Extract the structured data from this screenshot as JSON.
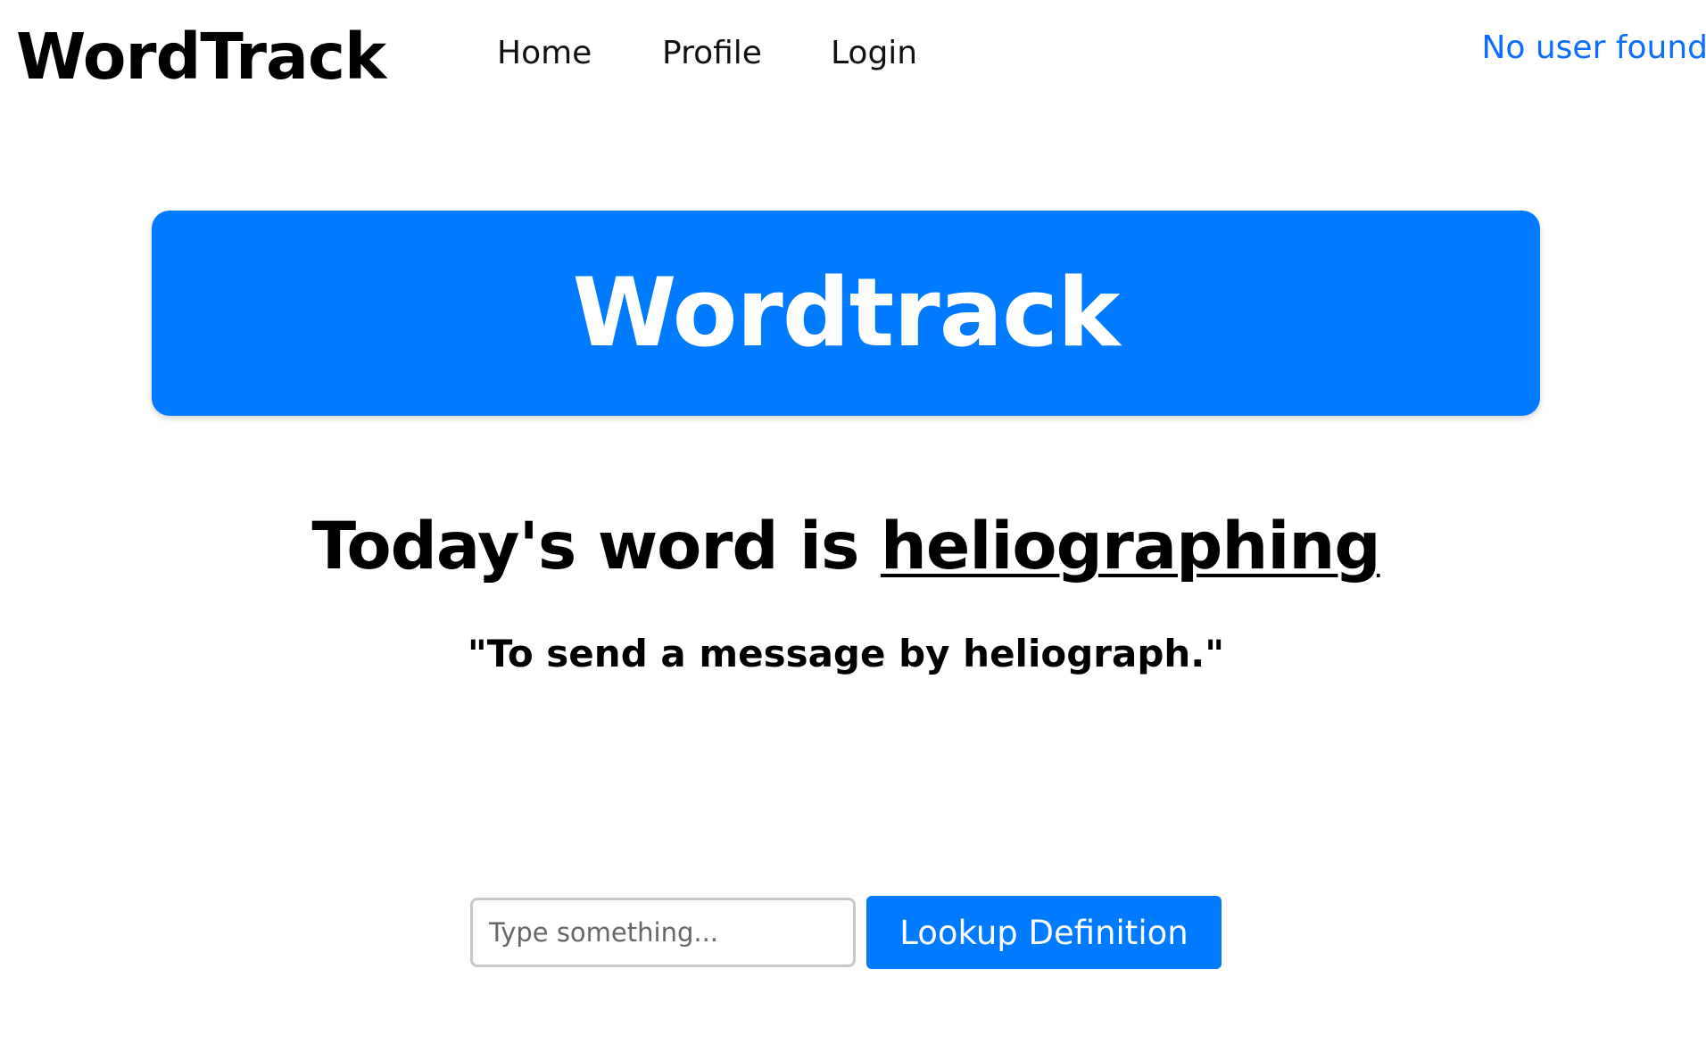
{
  "header": {
    "brand": "WordTrack",
    "nav": [
      {
        "label": "Home"
      },
      {
        "label": "Profile"
      },
      {
        "label": "Login"
      }
    ],
    "user_status": "No user found"
  },
  "hero": {
    "title": "Wordtrack"
  },
  "word_of_day": {
    "prefix": "Today's word is ",
    "word": "heliographing",
    "definition": "\"To send a message by heliograph.\""
  },
  "lookup": {
    "placeholder": "Type something...",
    "value": "",
    "button_label": "Lookup Definition"
  },
  "colors": {
    "primary": "#007bff",
    "link": "#0d6efd",
    "text": "#000000",
    "background": "#ffffff"
  }
}
